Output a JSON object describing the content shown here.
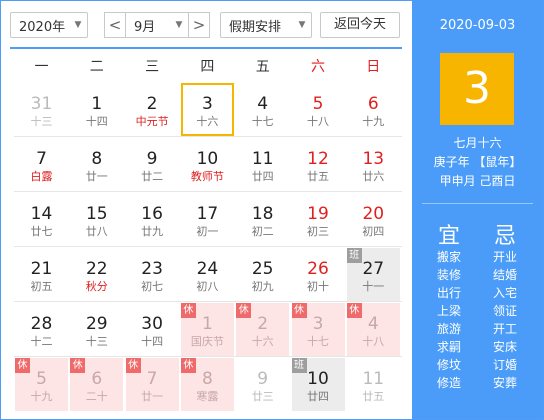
{
  "toolbar": {
    "year": "2020年",
    "prev": "<",
    "month": "9月",
    "next": ">",
    "holiday": "假期安排",
    "today": "返回今天"
  },
  "weekdays": [
    "一",
    "二",
    "三",
    "四",
    "五",
    "六",
    "日"
  ],
  "days": [
    {
      "n": "31",
      "l": "十三",
      "other": true
    },
    {
      "n": "1",
      "l": "十四"
    },
    {
      "n": "2",
      "l": "中元节",
      "fest": true
    },
    {
      "n": "3",
      "l": "十六",
      "sel": true
    },
    {
      "n": "4",
      "l": "十七"
    },
    {
      "n": "5",
      "l": "十八",
      "weekend": true
    },
    {
      "n": "6",
      "l": "十九",
      "weekend": true
    },
    {
      "n": "7",
      "l": "白露",
      "fest": true
    },
    {
      "n": "8",
      "l": "廿一"
    },
    {
      "n": "9",
      "l": "廿二"
    },
    {
      "n": "10",
      "l": "教师节",
      "fest": true
    },
    {
      "n": "11",
      "l": "廿四"
    },
    {
      "n": "12",
      "l": "廿五",
      "weekend": true
    },
    {
      "n": "13",
      "l": "廿六",
      "weekend": true
    },
    {
      "n": "14",
      "l": "廿七"
    },
    {
      "n": "15",
      "l": "廿八"
    },
    {
      "n": "16",
      "l": "廿九"
    },
    {
      "n": "17",
      "l": "初一"
    },
    {
      "n": "18",
      "l": "初二"
    },
    {
      "n": "19",
      "l": "初三",
      "weekend": true
    },
    {
      "n": "20",
      "l": "初四",
      "weekend": true
    },
    {
      "n": "21",
      "l": "初五"
    },
    {
      "n": "22",
      "l": "秋分",
      "fest": true
    },
    {
      "n": "23",
      "l": "初七"
    },
    {
      "n": "24",
      "l": "初八"
    },
    {
      "n": "25",
      "l": "初九"
    },
    {
      "n": "26",
      "l": "初十",
      "weekend": true
    },
    {
      "n": "27",
      "l": "十一",
      "badge": "班"
    },
    {
      "n": "28",
      "l": "十二"
    },
    {
      "n": "29",
      "l": "十三"
    },
    {
      "n": "30",
      "l": "十四"
    },
    {
      "n": "1",
      "l": "国庆节",
      "other": true,
      "badge": "休"
    },
    {
      "n": "2",
      "l": "十六",
      "other": true,
      "badge": "休"
    },
    {
      "n": "3",
      "l": "十七",
      "other": true,
      "badge": "休"
    },
    {
      "n": "4",
      "l": "十八",
      "other": true,
      "badge": "休"
    },
    {
      "n": "5",
      "l": "十九",
      "other": true,
      "badge": "休"
    },
    {
      "n": "6",
      "l": "二十",
      "other": true,
      "badge": "休"
    },
    {
      "n": "7",
      "l": "廿一",
      "other": true,
      "badge": "休"
    },
    {
      "n": "8",
      "l": "寒露",
      "other": true,
      "badge": "休"
    },
    {
      "n": "9",
      "l": "廿三",
      "other": true
    },
    {
      "n": "10",
      "l": "廿四",
      "other": true,
      "badge": "班"
    },
    {
      "n": "11",
      "l": "廿五",
      "other": true
    }
  ],
  "panel": {
    "date": "2020-09-03",
    "day": "3",
    "lunar": "七月十六",
    "ganzhi_year": "庚子年 【鼠年】",
    "ganzhi_md": "甲申月 己酉日",
    "yi_title": "宜",
    "ji_title": "忌",
    "yi": [
      "搬家",
      "装修",
      "出行",
      "上梁",
      "旅游",
      "求嗣",
      "修坟",
      "修造"
    ],
    "ji": [
      "开业",
      "结婚",
      "入宅",
      "领证",
      "开工",
      "安床",
      "订婚",
      "安葬"
    ]
  },
  "colors": {
    "accent": "#4a9cf8",
    "today": "#f7b500",
    "festival": "#e02020",
    "holiday_bg": "#fde5e5"
  }
}
